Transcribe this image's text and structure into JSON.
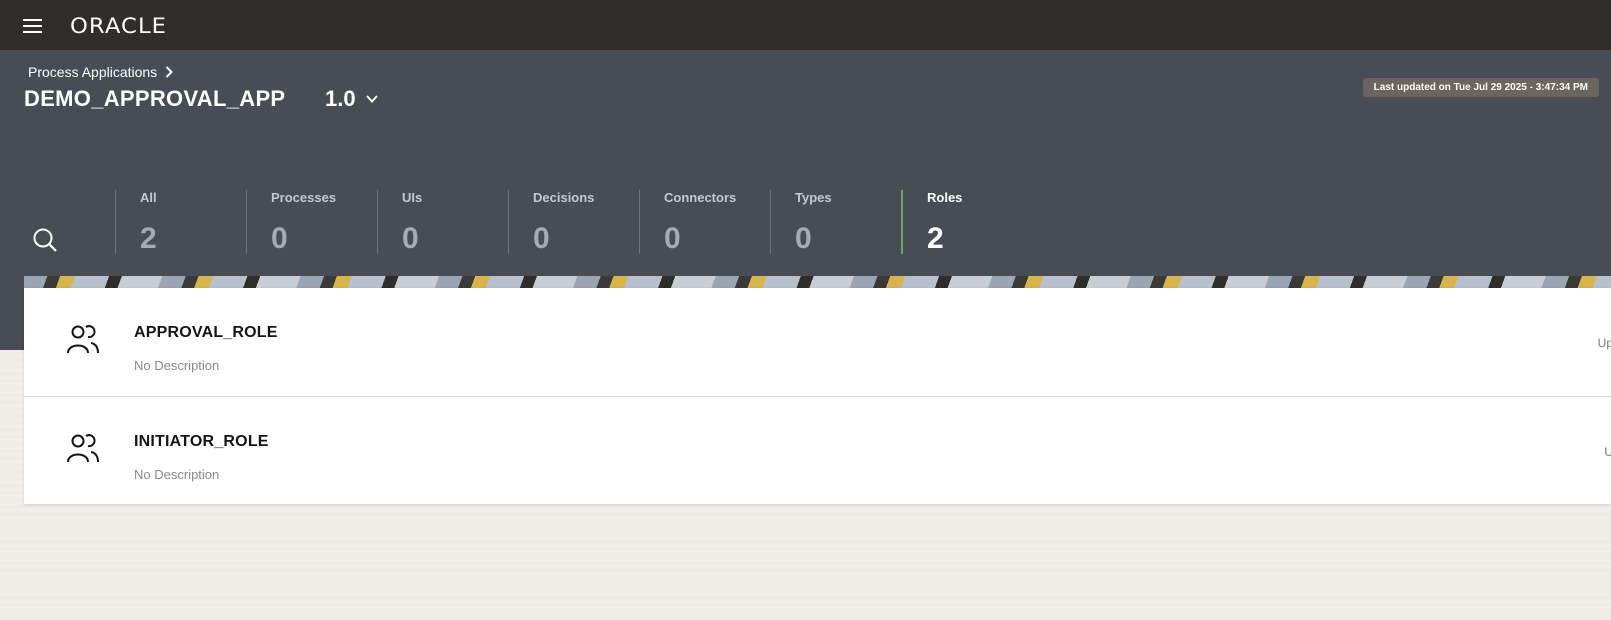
{
  "topbar": {
    "logo": "ORACLE",
    "menu_icon": "hamburger-icon"
  },
  "header": {
    "breadcrumb": "Process Applications",
    "app_name": "DEMO_APPROVAL_APP",
    "version": "1.0",
    "last_updated": "Last updated on Tue Jul 29 2025 - 3:47:34 PM"
  },
  "tabs": [
    {
      "label": "All",
      "count": "2"
    },
    {
      "label": "Processes",
      "count": "0"
    },
    {
      "label": "UIs",
      "count": "0"
    },
    {
      "label": "Decisions",
      "count": "0"
    },
    {
      "label": "Connectors",
      "count": "0"
    },
    {
      "label": "Types",
      "count": "0"
    },
    {
      "label": "Roles",
      "count": "2"
    }
  ],
  "active_tab": "Roles",
  "roles": [
    {
      "name": "APPROVAL_ROLE",
      "description": "No Description",
      "right_text": "Up"
    },
    {
      "name": "INITIATOR_ROLE",
      "description": "No Description",
      "right_text": "U"
    }
  ],
  "colors": {
    "topbar": "#312d2a",
    "header": "#474c55",
    "active_tab_border": "#6fa36b"
  }
}
